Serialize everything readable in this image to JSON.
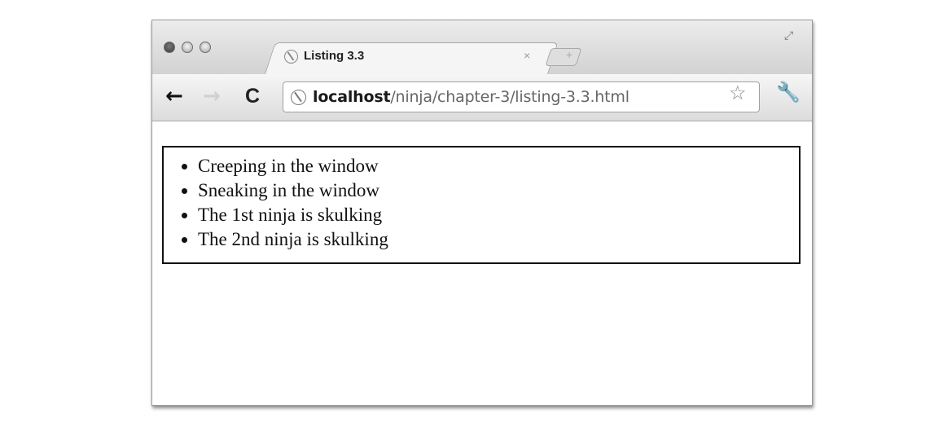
{
  "browser": {
    "tab": {
      "title": "Listing 3.3",
      "close_glyph": "×",
      "favicon_icon": "globe-icon"
    },
    "newtab_glyph": "+",
    "maximize_glyph": "⤢",
    "nav": {
      "back_glyph": "←",
      "forward_glyph": "→",
      "reload_glyph": "C"
    },
    "address": {
      "host": "localhost",
      "path": "/ninja/chapter-3/listing-3.3.html"
    },
    "bookmark_glyph": "☆",
    "wrench_glyph": "🔧"
  },
  "page": {
    "items": [
      "Creeping in the window",
      "Sneaking in the window",
      "The 1st ninja is skulking",
      "The 2nd ninja is skulking"
    ]
  }
}
